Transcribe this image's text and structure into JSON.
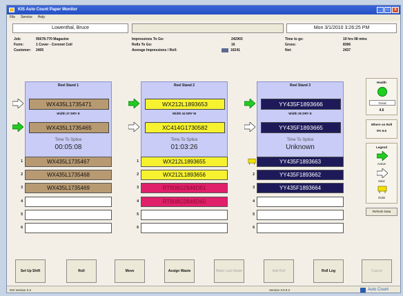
{
  "window": {
    "title": "KIS Auto Count Paper Monitor",
    "min_label": "_",
    "max_label": "□",
    "close_label": "x"
  },
  "menu": [
    "File",
    "Service",
    "Help"
  ],
  "header": {
    "operator": "Lowenthal, Bruce",
    "middle": "",
    "datetime": "Mon 3/1/2010 3:26:25 PM"
  },
  "info": {
    "col1": [
      {
        "k": "Job:",
        "v": "95678-770 Magazine"
      },
      {
        "k": "Form:",
        "v": "1 Cover - Coronet Coil"
      },
      {
        "k": "Customer:",
        "v": "2405"
      }
    ],
    "col2": [
      {
        "k": "Impressions To Go:",
        "v": "242903"
      },
      {
        "k": "Rolls To Go:",
        "v": "16"
      },
      {
        "k": "Average Impressions / Roll:",
        "v": "16241"
      }
    ],
    "col3": [
      {
        "k": "Time to go:",
        "v": "19 hrs 08 mins"
      },
      {
        "k": "Gross:",
        "v": "8396"
      },
      {
        "k": "Net:",
        "v": "2437"
      }
    ]
  },
  "stands": [
    {
      "title": "Reel Stand 1",
      "top_roll": "WX435L1735471",
      "top_color": "#b89a72",
      "top_text_color": "#111111",
      "width_label": "Width 37 DRY E",
      "bottom_roll": "WX435L1735465",
      "bottom_color": "#b89a72",
      "bottom_text_color": "#111111",
      "tts_label": "Time To Splice",
      "tts_value": "00:05:08",
      "top_arrow": "white",
      "bottom_arrow": "green",
      "queue": [
        {
          "n": "1",
          "text": "WX435L1735467",
          "color": "#b89a72",
          "fg": "#111111"
        },
        {
          "n": "2",
          "text": "WX435L1735468",
          "color": "#b89a72",
          "fg": "#111111"
        },
        {
          "n": "3",
          "text": "WX435L1735469",
          "color": "#b89a72",
          "fg": "#111111"
        },
        {
          "n": "4",
          "text": "",
          "color": "#ffffff",
          "fg": "#111111"
        },
        {
          "n": "5",
          "text": "",
          "color": "#ffffff",
          "fg": "#111111"
        },
        {
          "n": "6",
          "text": "",
          "color": "#ffffff",
          "fg": "#111111"
        }
      ]
    },
    {
      "title": "Reel Stand 2",
      "top_roll": "WX212L1893653",
      "top_color": "#f6f230",
      "top_text_color": "#111111",
      "width_label": "Width 34 DRY M",
      "bottom_roll": "XC414G1730582",
      "bottom_color": "#f6f230",
      "bottom_text_color": "#111111",
      "tts_label": "Time To Splice",
      "tts_value": "01:03:26",
      "top_arrow": "green",
      "bottom_arrow": "white",
      "queue": [
        {
          "n": "1",
          "text": "WX212L1893655",
          "color": "#f6f230",
          "fg": "#111111"
        },
        {
          "n": "2",
          "text": "WX212L1893656",
          "color": "#f6f230",
          "fg": "#111111"
        },
        {
          "n": "3",
          "text": "RT808G2846D61",
          "color": "#e0206a",
          "fg": "#8a0a30"
        },
        {
          "n": "4",
          "text": "RT808G2846D60",
          "color": "#e0206a",
          "fg": "#8a0a30"
        },
        {
          "n": "5",
          "text": "",
          "color": "#ffffff",
          "fg": "#111111"
        },
        {
          "n": "6",
          "text": "",
          "color": "#ffffff",
          "fg": "#111111"
        }
      ]
    },
    {
      "title": "Reel Stand 3",
      "top_roll": "YY435F1893666",
      "top_color": "#1e1a5a",
      "top_text_color": "#ffffff",
      "width_label": "Width 35 DRY E",
      "bottom_roll": "YY435F1893665",
      "bottom_color": "#1e1a5a",
      "bottom_text_color": "#ffffff",
      "tts_label": "Time To Splice",
      "tts_value": "Unknown",
      "top_arrow": "green",
      "bottom_arrow": "white",
      "queue": [
        {
          "n": "1",
          "text": "YY435F1893663",
          "color": "#1e1a5a",
          "fg": "#ffffff"
        },
        {
          "n": "2",
          "text": "YY435F1893662",
          "color": "#1e1a5a",
          "fg": "#ffffff"
        },
        {
          "n": "3",
          "text": "YY435F1893664",
          "color": "#1e1a5a",
          "fg": "#ffffff"
        },
        {
          "n": "4",
          "text": "",
          "color": "#ffffff",
          "fg": "#111111"
        },
        {
          "n": "5",
          "text": "",
          "color": "#ffffff",
          "fg": "#111111"
        },
        {
          "n": "6",
          "text": "",
          "color": "#ffffff",
          "fg": "#111111"
        }
      ]
    }
  ],
  "side": {
    "health_label": "Health",
    "health_status": "Good",
    "health_value": "4.6",
    "where_label": "Where on Roll",
    "where_values": "0% 5.6",
    "legend_label": "Legend",
    "legend_active": "Active",
    "legend_next": "Next",
    "legend_grab": "Grab",
    "refresh_label": "Refresh Data"
  },
  "buttons": [
    {
      "label": "Set Up Shift",
      "disabled": false
    },
    {
      "label": "Roll",
      "disabled": false
    },
    {
      "label": "Move",
      "disabled": false
    },
    {
      "label": "Assign Waste",
      "disabled": false
    },
    {
      "label": "Make Last Waste",
      "disabled": true
    },
    {
      "label": "Add Roll",
      "disabled": true
    },
    {
      "label": "Roll Log",
      "disabled": false
    },
    {
      "label": "Cancel",
      "disabled": true
    }
  ],
  "status": {
    "left": "KIS Version 2.2",
    "center": "Version 3.0.0.2",
    "brand": "Auto Count"
  }
}
